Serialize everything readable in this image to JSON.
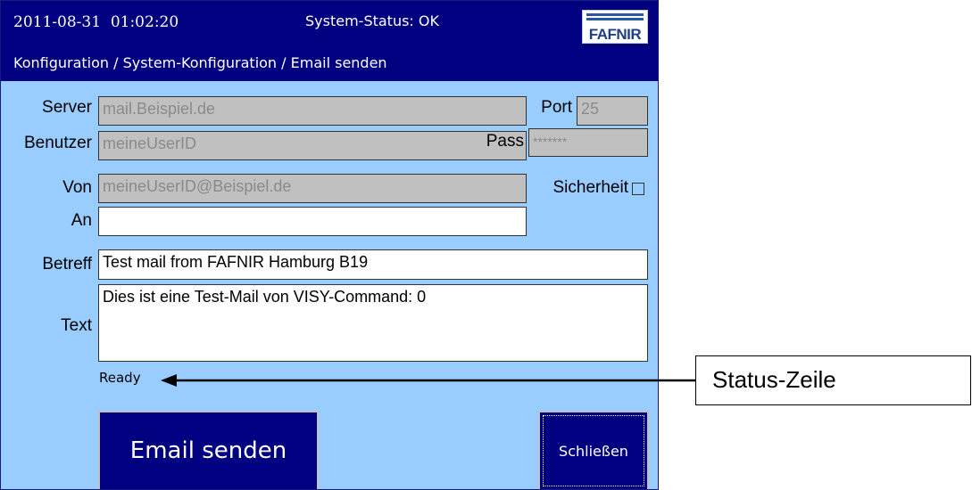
{
  "header": {
    "datetime": "2011-08-31  01:02:20",
    "system_status": "System-Status: OK",
    "breadcrumb": "Konfiguration / System-Konfiguration / Email senden",
    "logo_text": "FAFNIR"
  },
  "form": {
    "server": {
      "label": "Server",
      "value": "mail.Beispiel.de"
    },
    "port": {
      "label": "Port",
      "value": "25"
    },
    "benutzer": {
      "label": "Benutzer",
      "value": "meineUserID"
    },
    "pass": {
      "label": "Pass",
      "value": "*******"
    },
    "von": {
      "label": "Von",
      "value": "meineUserID@Beispiel.de"
    },
    "sicherheit": {
      "label": "Sicherheit",
      "checked": false
    },
    "an": {
      "label": "An",
      "value": ""
    },
    "betreff": {
      "label": "Betreff",
      "value": "Test mail from FAFNIR Hamburg B19"
    },
    "text": {
      "label": "Text",
      "value": "Dies ist eine Test-Mail von VISY-Command: 0"
    }
  },
  "status_line": "Ready",
  "buttons": {
    "send": "Email senden",
    "close": "Schließen"
  },
  "annotation": {
    "label": "Status-Zeile"
  },
  "colors": {
    "header_bg": "#000080",
    "screen_bg": "#99ccff",
    "disabled_field_bg": "#c0c0c0",
    "button_bg": "#000080"
  }
}
